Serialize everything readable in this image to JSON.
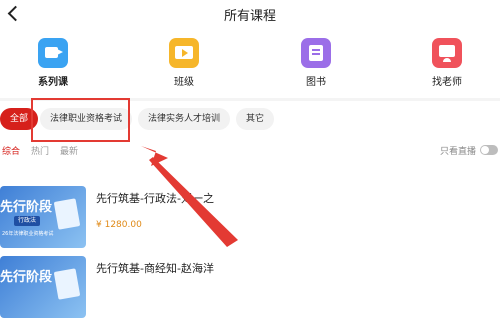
{
  "header": {
    "title": "所有课程"
  },
  "categories": [
    {
      "label": "系列课",
      "icon": "video-icon"
    },
    {
      "label": "班级",
      "icon": "classroom-icon"
    },
    {
      "label": "图书",
      "icon": "book-icon"
    },
    {
      "label": "找老师",
      "icon": "teacher-icon"
    }
  ],
  "filters": [
    "全部",
    "法律职业资格考试",
    "法律实务人才培训",
    "其它"
  ],
  "sorts": [
    "综合",
    "热门",
    "最新"
  ],
  "live_only_label": "只看直播",
  "live_only_enabled": false,
  "courses": [
    {
      "title": "先行筑基-行政法-刘一之",
      "price": "¥ 1280.00",
      "thumb_title": "先行阶段",
      "thumb_tag": "行政法",
      "thumb_desc": "26年法律职业资格考试"
    },
    {
      "title": "先行筑基-商经知-赵海洋",
      "price": "",
      "thumb_title": "先行阶段",
      "thumb_tag": "",
      "thumb_desc": ""
    }
  ],
  "colors": {
    "accent": "#d6201b",
    "price": "#e08a17",
    "annotation": "#e33a33"
  }
}
